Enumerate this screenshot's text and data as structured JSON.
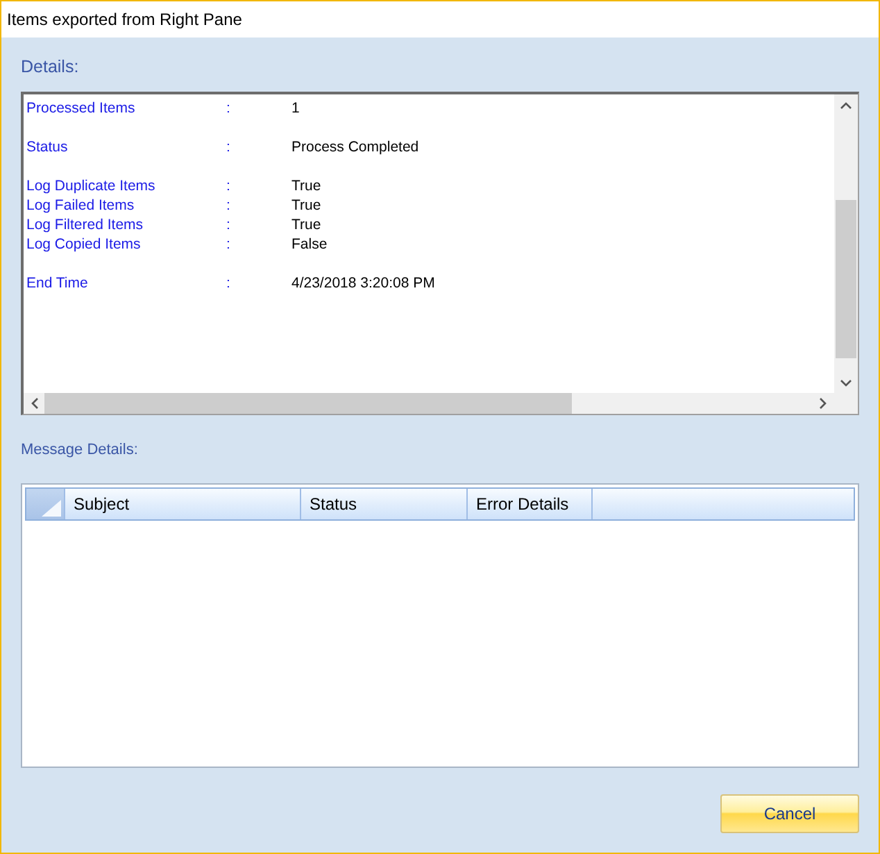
{
  "window": {
    "title": "Items exported from Right Pane"
  },
  "details": {
    "label": "Details:",
    "sections": [
      [
        {
          "name": "Processed Items",
          "sep": ":",
          "value": "1"
        }
      ],
      [
        {
          "name": "Status",
          "sep": ":",
          "value": "Process Completed"
        }
      ],
      [
        {
          "name": "Log Duplicate Items",
          "sep": ":",
          "value": "True"
        },
        {
          "name": "Log Failed Items",
          "sep": ":",
          "value": "True"
        },
        {
          "name": "Log Filtered Items",
          "sep": ":",
          "value": "True"
        },
        {
          "name": "Log Copied Items",
          "sep": ":",
          "value": "False"
        }
      ],
      [
        {
          "name": "End Time",
          "sep": ":",
          "value": "4/23/2018 3:20:08 PM"
        }
      ]
    ]
  },
  "message_details": {
    "label": "Message Details:",
    "columns": [
      "Subject",
      "Status",
      "Error Details"
    ]
  },
  "buttons": [
    "Cancel"
  ]
}
